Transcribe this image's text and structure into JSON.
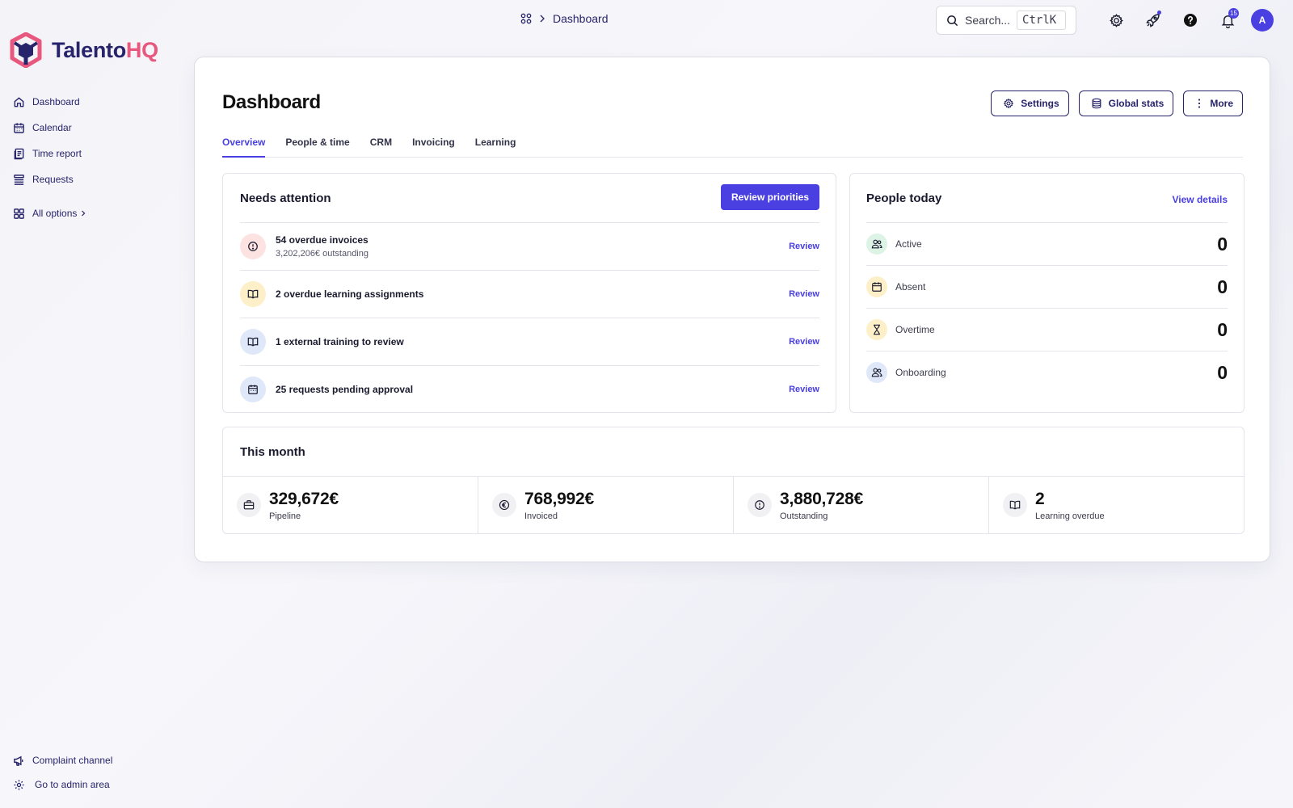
{
  "brand": {
    "name_part1": "Talento",
    "name_part2": "HQ",
    "primary_color": "#27246b",
    "accent_color": "#e8577e",
    "action_color": "#4a3fe0"
  },
  "sidebar": {
    "items": [
      {
        "label": "Dashboard",
        "icon": "home-icon"
      },
      {
        "label": "Calendar",
        "icon": "calendar-icon"
      },
      {
        "label": "Time report",
        "icon": "document-icon"
      },
      {
        "label": "Requests",
        "icon": "list-icon"
      }
    ],
    "all_options": "All options",
    "bottom": [
      {
        "label": "Complaint channel",
        "icon": "megaphone-icon"
      },
      {
        "label": "Go to admin area",
        "icon": "gear-icon"
      }
    ]
  },
  "topbar": {
    "breadcrumb": "Dashboard",
    "search_placeholder": "Search...",
    "search_shortcut": "CtrlK",
    "notification_count": "15",
    "avatar_initial": "A"
  },
  "page": {
    "title": "Dashboard",
    "buttons": {
      "settings": "Settings",
      "global_stats": "Global stats",
      "more": "More"
    },
    "tabs": [
      "Overview",
      "People & time",
      "CRM",
      "Invoicing",
      "Learning"
    ],
    "active_tab": "Overview"
  },
  "needs_attention": {
    "title": "Needs attention",
    "action": "Review priorities",
    "items": [
      {
        "title": "54 overdue invoices",
        "subtitle": "3,202,206€ outstanding",
        "action": "Review",
        "icon": "alert-circle-icon",
        "color": "#fde2e2"
      },
      {
        "title": "2 overdue learning assignments",
        "action": "Review",
        "icon": "book-icon",
        "color": "#fdf0c8"
      },
      {
        "title": "1 external training to review",
        "action": "Review",
        "icon": "book-icon",
        "color": "#dfe8f8"
      },
      {
        "title": "25 requests pending approval",
        "action": "Review",
        "icon": "calendar-icon",
        "color": "#dfe8f8"
      }
    ]
  },
  "people_today": {
    "title": "People today",
    "link": "View details",
    "rows": [
      {
        "label": "Active",
        "value": "0",
        "icon": "users-icon",
        "color": "#dcf3e6"
      },
      {
        "label": "Absent",
        "value": "0",
        "icon": "calendar-icon",
        "color": "#fdf0c8"
      },
      {
        "label": "Overtime",
        "value": "0",
        "icon": "hourglass-icon",
        "color": "#fdf0c8"
      },
      {
        "label": "Onboarding",
        "value": "0",
        "icon": "users-icon",
        "color": "#dfe8f8"
      }
    ]
  },
  "this_month": {
    "title": "This month",
    "stats": [
      {
        "value": "329,672€",
        "label": "Pipeline",
        "icon": "briefcase-icon"
      },
      {
        "value": "768,992€",
        "label": "Invoiced",
        "icon": "euro-icon"
      },
      {
        "value": "3,880,728€",
        "label": "Outstanding",
        "icon": "alert-circle-icon"
      },
      {
        "value": "2",
        "label": "Learning overdue",
        "icon": "book-icon"
      }
    ]
  }
}
